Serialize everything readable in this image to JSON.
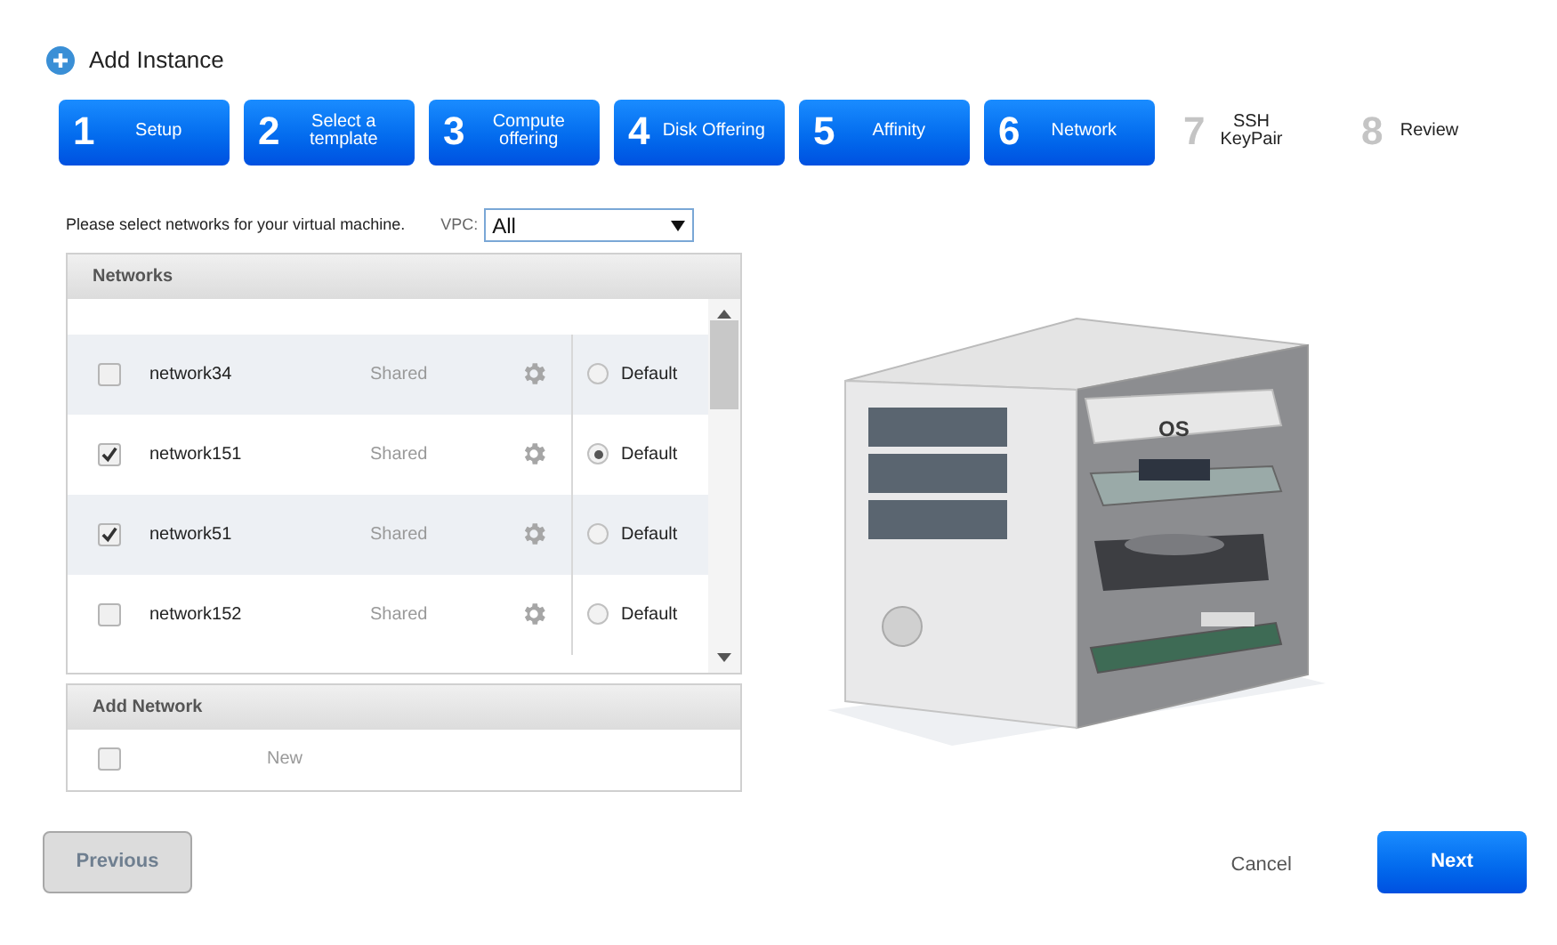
{
  "title": "Add Instance",
  "steps": [
    {
      "number": "1",
      "label": "Setup",
      "reached": true
    },
    {
      "number": "2",
      "label": "Select a template",
      "reached": true
    },
    {
      "number": "3",
      "label": "Compute offering",
      "reached": true
    },
    {
      "number": "4",
      "label": "Disk Offering",
      "reached": true
    },
    {
      "number": "5",
      "label": "Affinity",
      "reached": true
    },
    {
      "number": "6",
      "label": "Network",
      "reached": true
    },
    {
      "number": "7",
      "label": "SSH KeyPair",
      "reached": false
    },
    {
      "number": "8",
      "label": "Review",
      "reached": false
    }
  ],
  "instruction": "Please select networks for your virtual machine.",
  "vpc": {
    "label": "VPC:",
    "value": "All"
  },
  "networks": {
    "title": "Networks",
    "rows": [
      {
        "name": "network34",
        "type": "Shared",
        "checked": false,
        "default_label": "Default",
        "default": false
      },
      {
        "name": "network151",
        "type": "Shared",
        "checked": true,
        "default_label": "Default",
        "default": true
      },
      {
        "name": "network51",
        "type": "Shared",
        "checked": true,
        "default_label": "Default",
        "default": false
      },
      {
        "name": "network152",
        "type": "Shared",
        "checked": false,
        "default_label": "Default",
        "default": false
      }
    ]
  },
  "add_network": {
    "title": "Add Network",
    "label": "New",
    "checked": false
  },
  "illustration": {
    "label": "OS"
  },
  "buttons": {
    "previous": "Previous",
    "cancel": "Cancel",
    "next": "Next"
  }
}
